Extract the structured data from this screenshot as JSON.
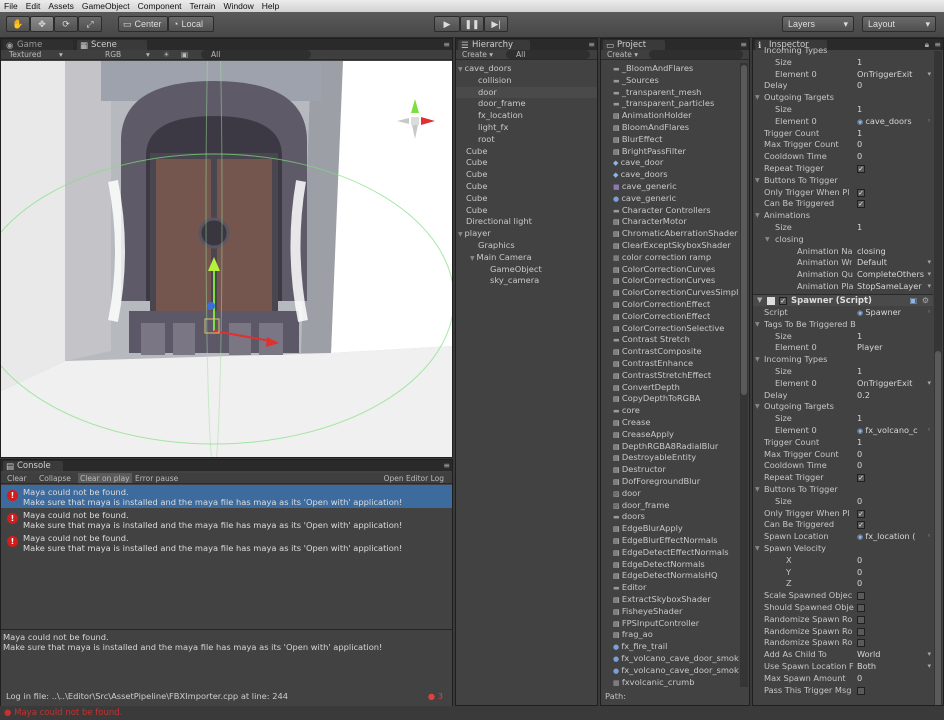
{
  "menubar": [
    "File",
    "Edit",
    "Assets",
    "GameObject",
    "Component",
    "Terrain",
    "Window",
    "Help"
  ],
  "toolbar": {
    "pivot": "Center",
    "space": "Local",
    "layers": "Layers",
    "layout": "Layout"
  },
  "scene": {
    "tab_game": "Game",
    "tab_scene": "Scene",
    "shading": "Textured",
    "mode": "RGB",
    "all": "All"
  },
  "hierarchy": {
    "title": "Hierarchy",
    "create": "Create",
    "search": "All",
    "items": [
      {
        "label": "cave_doors",
        "indent": 0,
        "fold": true
      },
      {
        "label": "collision",
        "indent": 1
      },
      {
        "label": "door",
        "indent": 1,
        "selected": true
      },
      {
        "label": "door_frame",
        "indent": 1
      },
      {
        "label": "fx_location",
        "indent": 1
      },
      {
        "label": "light_fx",
        "indent": 1
      },
      {
        "label": "root",
        "indent": 1
      },
      {
        "label": "Cube",
        "indent": 0
      },
      {
        "label": "Cube",
        "indent": 0
      },
      {
        "label": "Cube",
        "indent": 0
      },
      {
        "label": "Cube",
        "indent": 0
      },
      {
        "label": "Cube",
        "indent": 0
      },
      {
        "label": "Cube",
        "indent": 0
      },
      {
        "label": "Directional light",
        "indent": 0
      },
      {
        "label": "player",
        "indent": 0,
        "fold": true
      },
      {
        "label": "Graphics",
        "indent": 1
      },
      {
        "label": "Main Camera",
        "indent": 1,
        "fold": true
      },
      {
        "label": "GameObject",
        "indent": 2
      },
      {
        "label": "sky_camera",
        "indent": 2
      }
    ]
  },
  "project": {
    "title": "Project",
    "create": "Create",
    "path_label": "Path:",
    "items": [
      {
        "label": "_BloomAndFlares",
        "icon": "folder"
      },
      {
        "label": "_Sources",
        "icon": "folder"
      },
      {
        "label": "_transparent_mesh",
        "icon": "folder"
      },
      {
        "label": "_transparent_particles",
        "icon": "folder"
      },
      {
        "label": "AnimationHolder",
        "icon": "script"
      },
      {
        "label": "BloomAndFlares",
        "icon": "script"
      },
      {
        "label": "BlurEffect",
        "icon": "script"
      },
      {
        "label": "BrightPassFilter",
        "icon": "script"
      },
      {
        "label": "cave_door",
        "icon": "mesh"
      },
      {
        "label": "cave_doors",
        "icon": "mesh"
      },
      {
        "label": "cave_generic",
        "icon": "material"
      },
      {
        "label": "cave_generic",
        "icon": "sphere"
      },
      {
        "label": "Character Controllers",
        "icon": "folder"
      },
      {
        "label": "CharacterMotor",
        "icon": "script"
      },
      {
        "label": "ChromaticAberrationShader",
        "icon": "script"
      },
      {
        "label": "ClearExceptSkyboxShader",
        "icon": "script"
      },
      {
        "label": "color correction ramp",
        "icon": "texture"
      },
      {
        "label": "ColorCorrectionCurves",
        "icon": "script"
      },
      {
        "label": "ColorCorrectionCurves",
        "icon": "script"
      },
      {
        "label": "ColorCorrectionCurvesSimple",
        "icon": "script"
      },
      {
        "label": "ColorCorrectionEffect",
        "icon": "script"
      },
      {
        "label": "ColorCorrectionEffect",
        "icon": "script"
      },
      {
        "label": "ColorCorrectionSelective",
        "icon": "script"
      },
      {
        "label": "Contrast Stretch",
        "icon": "folder"
      },
      {
        "label": "ContrastComposite",
        "icon": "script"
      },
      {
        "label": "ContrastEnhance",
        "icon": "script"
      },
      {
        "label": "ContrastStretchEffect",
        "icon": "script"
      },
      {
        "label": "ConvertDepth",
        "icon": "script"
      },
      {
        "label": "CopyDepthToRGBA",
        "icon": "script"
      },
      {
        "label": "core",
        "icon": "folder"
      },
      {
        "label": "Crease",
        "icon": "script"
      },
      {
        "label": "CreaseApply",
        "icon": "script"
      },
      {
        "label": "DepthRGBA8RadialBlur",
        "icon": "script"
      },
      {
        "label": "DestroyableEntity",
        "icon": "script"
      },
      {
        "label": "Destructor",
        "icon": "script"
      },
      {
        "label": "DofForegroundBlur",
        "icon": "script"
      },
      {
        "label": "door",
        "icon": "prefab"
      },
      {
        "label": "door_frame",
        "icon": "prefab"
      },
      {
        "label": "doors",
        "icon": "folder"
      },
      {
        "label": "EdgeBlurApply",
        "icon": "script"
      },
      {
        "label": "EdgeBlurEffectNormals",
        "icon": "script"
      },
      {
        "label": "EdgeDetectEffectNormals",
        "icon": "script"
      },
      {
        "label": "EdgeDetectNormals",
        "icon": "script"
      },
      {
        "label": "EdgeDetectNormalsHQ",
        "icon": "script"
      },
      {
        "label": "Editor",
        "icon": "folder"
      },
      {
        "label": "ExtractSkyboxShader",
        "icon": "script"
      },
      {
        "label": "FisheyeShader",
        "icon": "script"
      },
      {
        "label": "FPSInputController",
        "icon": "script"
      },
      {
        "label": "frag_ao",
        "icon": "script"
      },
      {
        "label": "fx_fire_trail",
        "icon": "sphere"
      },
      {
        "label": "fx_volcano_cave_door_smoke",
        "icon": "sphere"
      },
      {
        "label": "fx_volcano_cave_door_smoke",
        "icon": "sphere"
      },
      {
        "label": "fxvolcanic_crumb",
        "icon": "texture"
      }
    ]
  },
  "inspector": {
    "title": "Inspector",
    "rows1": [
      {
        "label": "Incoming Types",
        "value": "",
        "indent": 1
      },
      {
        "label": "Size",
        "value": "1",
        "indent": 2
      },
      {
        "label": "Element 0",
        "value": "OnTriggerExit",
        "indent": 2,
        "dropdown": true
      },
      {
        "label": "Delay",
        "value": "0",
        "indent": 1
      },
      {
        "label": "Outgoing Targets",
        "value": "",
        "indent": 1,
        "fold": true
      },
      {
        "label": "Size",
        "value": "1",
        "indent": 2
      },
      {
        "label": "Element 0",
        "value": "cave_doors",
        "indent": 2,
        "obj": true
      },
      {
        "label": "Trigger Count",
        "value": "1",
        "indent": 1
      },
      {
        "label": "Max Trigger Count",
        "value": "0",
        "indent": 1
      },
      {
        "label": "Cooldown Time",
        "value": "0",
        "indent": 1
      },
      {
        "label": "Repeat Trigger",
        "value": "",
        "indent": 1,
        "check": true
      },
      {
        "label": "Buttons To Trigger",
        "value": "",
        "indent": 1,
        "fold": true
      },
      {
        "label": "Only Trigger When Pl",
        "value": "",
        "indent": 1,
        "check": true
      },
      {
        "label": "Can Be Triggered",
        "value": "",
        "indent": 1,
        "check": true
      },
      {
        "label": "Animations",
        "value": "",
        "indent": 1,
        "fold": true
      },
      {
        "label": "Size",
        "value": "1",
        "indent": 2
      },
      {
        "label": "closing",
        "value": "",
        "indent": 2,
        "fold": true
      },
      {
        "label": "Animation Na",
        "value": "closing",
        "indent": 4
      },
      {
        "label": "Animation Wr",
        "value": "Default",
        "indent": 4,
        "dropdown": true
      },
      {
        "label": "Animation Qu",
        "value": "CompleteOthers",
        "indent": 4,
        "dropdown": true
      },
      {
        "label": "Animation Pla",
        "value": "StopSameLayer",
        "indent": 4,
        "dropdown": true
      }
    ],
    "component": "Spawner (Script)",
    "rows2": [
      {
        "label": "Script",
        "value": "Spawner",
        "indent": 1,
        "obj": true
      },
      {
        "label": "Tags To Be Triggered By",
        "value": "",
        "indent": 1,
        "fold": true
      },
      {
        "label": "Size",
        "value": "1",
        "indent": 2
      },
      {
        "label": "Element 0",
        "value": "Player",
        "indent": 2
      },
      {
        "label": "Incoming Types",
        "value": "",
        "indent": 1,
        "fold": true
      },
      {
        "label": "Size",
        "value": "1",
        "indent": 2
      },
      {
        "label": "Element 0",
        "value": "OnTriggerExit",
        "indent": 2,
        "dropdown": true
      },
      {
        "label": "Delay",
        "value": "0.2",
        "indent": 1
      },
      {
        "label": "Outgoing Targets",
        "value": "",
        "indent": 1,
        "fold": true
      },
      {
        "label": "Size",
        "value": "1",
        "indent": 2
      },
      {
        "label": "Element 0",
        "value": "fx_volcano_c",
        "indent": 2,
        "obj": true
      },
      {
        "label": "Trigger Count",
        "value": "1",
        "indent": 1
      },
      {
        "label": "Max Trigger Count",
        "value": "0",
        "indent": 1
      },
      {
        "label": "Cooldown Time",
        "value": "0",
        "indent": 1
      },
      {
        "label": "Repeat Trigger",
        "value": "",
        "indent": 1,
        "check": true
      },
      {
        "label": "Buttons To Trigger",
        "value": "",
        "indent": 1,
        "fold": true
      },
      {
        "label": "Size",
        "value": "0",
        "indent": 2
      },
      {
        "label": "Only Trigger When Pl",
        "value": "",
        "indent": 1,
        "check": true
      },
      {
        "label": "Can Be Triggered",
        "value": "",
        "indent": 1,
        "check": true
      },
      {
        "label": "Spawn Location",
        "value": "fx_location (",
        "indent": 1,
        "obj": true
      },
      {
        "label": "Spawn Velocity",
        "value": "",
        "indent": 1,
        "fold": true
      },
      {
        "label": "X",
        "value": "0",
        "indent": 3
      },
      {
        "label": "Y",
        "value": "0",
        "indent": 3
      },
      {
        "label": "Z",
        "value": "0",
        "indent": 3
      },
      {
        "label": "Scale Spawned Objec",
        "value": "",
        "indent": 1,
        "checkoff": true
      },
      {
        "label": "Should Spawned Obje",
        "value": "",
        "indent": 1,
        "checkoff": true
      },
      {
        "label": "Randomize Spawn Ro",
        "value": "",
        "indent": 1,
        "checkoff": true
      },
      {
        "label": "Randomize Spawn Ro",
        "value": "",
        "indent": 1,
        "checkoff": true
      },
      {
        "label": "Randomize Spawn Ro",
        "value": "",
        "indent": 1,
        "checkoff": true
      },
      {
        "label": "Add As Child To",
        "value": "World",
        "indent": 1,
        "dropdown": true
      },
      {
        "label": "Use Spawn Location F",
        "value": "Both",
        "indent": 1,
        "dropdown": true
      },
      {
        "label": "Max Spawn Amount",
        "value": "0",
        "indent": 1
      },
      {
        "label": "Pass This Trigger Msg",
        "value": "",
        "indent": 1,
        "checkoff": true
      }
    ]
  },
  "console": {
    "title": "Console",
    "buttons": [
      "Clear",
      "Collapse",
      "Clear on play",
      "Error pause"
    ],
    "open_log": "Open Editor Log",
    "entries": [
      {
        "line1": "Maya could not be found.",
        "line2": "Make sure that maya is installed and the maya file has maya as its 'Open with' application!",
        "selected": true
      },
      {
        "line1": "Maya could not be found.",
        "line2": "Make sure that maya is installed and the maya file has maya as its 'Open with' application!"
      },
      {
        "line1": "Maya could not be found.",
        "line2": "Make sure that maya is installed and the maya file has maya as its 'Open with' application!"
      }
    ],
    "detail_line1": "Maya could not be found.",
    "detail_line2": "Make sure that maya is installed and the maya file has maya as its 'Open with' application!",
    "detail_line3": "Log in file: ..\\..\\Editor\\Src\\AssetPipeline\\FBXImporter.cpp at line: 244",
    "error_count": "3"
  },
  "status": {
    "text": "Maya could not be found."
  },
  "colors": {
    "selection": "#3d6b9e",
    "error": "#d01d1d",
    "accent_blue": "#8fb7e6"
  }
}
